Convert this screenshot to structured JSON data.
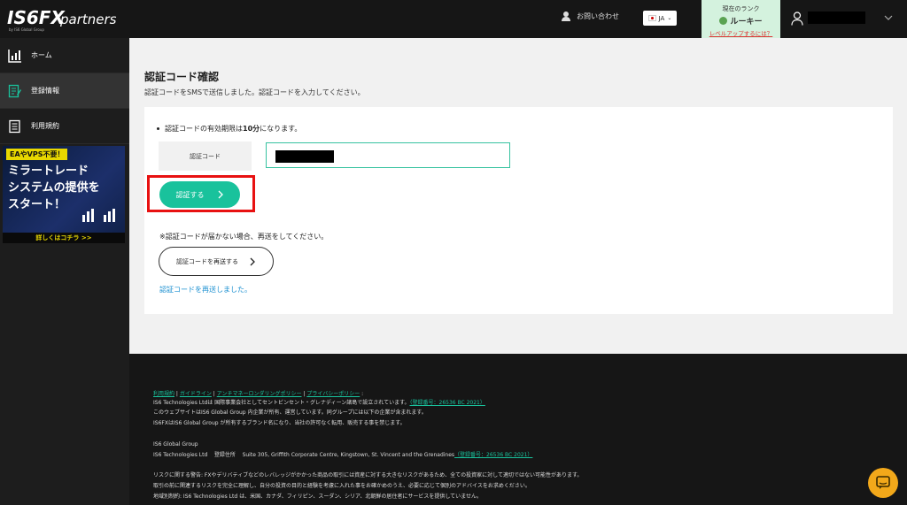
{
  "header": {
    "logo_text": "IS6FX partners",
    "logo_sub": "by IS6 Global Group",
    "contact_label": "お問い合わせ",
    "lang": "JA",
    "rank_label": "現在のランク",
    "rank_value": "ルーキー",
    "rank_upgrade_link": "レベルアップするには？"
  },
  "sidebar": {
    "items": [
      {
        "label": "ホーム",
        "icon": "chart-icon"
      },
      {
        "label": "登録情報",
        "icon": "edit-doc-icon"
      },
      {
        "label": "利用規約",
        "icon": "document-icon"
      }
    ],
    "banner": {
      "tag": "EAやVPS不要！",
      "main": "ミラートレード\nシステムの提供を\nスタート！",
      "more": "詳しくはコチラ >>"
    }
  },
  "main": {
    "title": "認証コード確認",
    "subtitle": "認証コードをSMSで送信しました。認証コードを入力してください。",
    "note_prefix": "認証コードの有効期限は",
    "note_value": "10分",
    "note_suffix": "になります。",
    "field_label": "認証コード",
    "verify_button": "認証する",
    "resend_note": "※認証コードが届かない場合、再送をしてください。",
    "resend_button": "認証コードを再送する",
    "resent_message": "認証コードを再送しました。"
  },
  "footer": {
    "link1": "利用規約",
    "link2": "ガイドライン",
    "link3": "アンチマネーロンダリングポリシー",
    "link4": "プライバシーポリシー",
    "line1": "IS6 Technologies Ltdは 国際事業会社としてセントビンセント・グレナディーン諸島で設立されています。",
    "reg1": "（登録番号：26536 BC 2021）",
    "line2": "このウェブサイトはIS6 Global Group 内企業が所有、運営しています。同グループには以下の企業が含まれます。",
    "line3": "IS6FXはIS6 Global Group が所有するブランド名になり、当社の許可なく転用、販売する事を禁じます。",
    "group": "IS6 Global Group",
    "company": "IS6 Technologies Ltd",
    "address_label": "登録住所",
    "address": "Suite 305, Griffith Corporate Centre, Kingstown, St. Vincent and the Grenadines",
    "reg2": "（登録番号：26536 BC 2021）",
    "risk1": "リスクに関する警告: FXやデリバティブなどのレバレッジがかかった商品の取引には資産に対する大きなリスクがあるため、全ての投資家に対して適切ではない可能性があります。",
    "risk2": "取引の前に関連するリスクを完全に理解し、自分の投資の目的と経験を考慮に入れた事をお確かめのうえ、必要に応じて個別のアドバイスをお求めください。",
    "risk3": "地域別制約: IS6 Technologies Ltd は、米国、カナダ、フィリピン、スーダン、シリア、北朝鮮の居住者にサービスを提供していません。"
  },
  "colors": {
    "accent": "#19c29c",
    "highlight": "#e81111",
    "chat": "#f2a81a"
  }
}
